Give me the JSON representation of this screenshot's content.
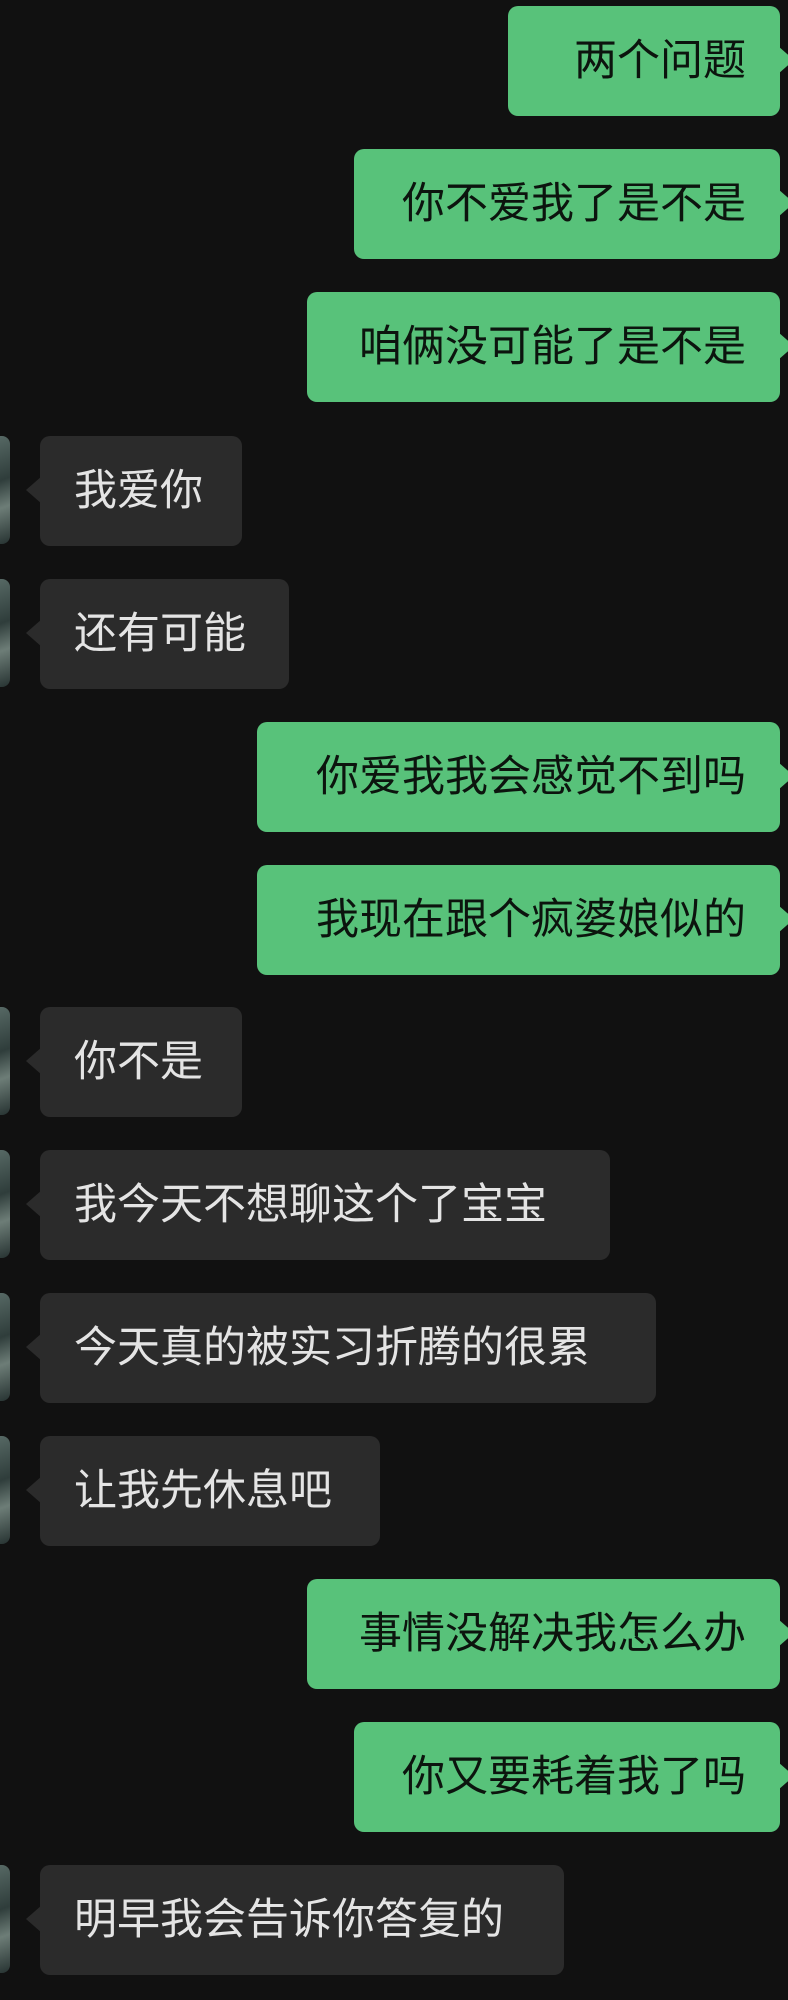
{
  "colors": {
    "background": "#111111",
    "outgoing_bubble": "#58c27a",
    "incoming_bubble": "#2b2b2b",
    "incoming_text": "#e4e4e4",
    "outgoing_text": "#0c140e"
  },
  "messages": [
    {
      "side": "outgoing",
      "text": "两个问题"
    },
    {
      "side": "outgoing",
      "text": "你不爱我了是不是"
    },
    {
      "side": "outgoing",
      "text": "咱俩没可能了是不是"
    },
    {
      "side": "incoming",
      "text": "我爱你"
    },
    {
      "side": "incoming",
      "text": "还有可能"
    },
    {
      "side": "outgoing",
      "text": "你爱我我会感觉不到吗"
    },
    {
      "side": "outgoing",
      "text": "我现在跟个疯婆娘似的"
    },
    {
      "side": "incoming",
      "text": "你不是"
    },
    {
      "side": "incoming",
      "text": "我今天不想聊这个了宝宝"
    },
    {
      "side": "incoming",
      "text": "今天真的被实习折腾的很累"
    },
    {
      "side": "incoming",
      "text": "让我先休息吧"
    },
    {
      "side": "outgoing",
      "text": "事情没解决我怎么办"
    },
    {
      "side": "outgoing",
      "text": "你又要耗着我了吗"
    },
    {
      "side": "incoming",
      "text": "明早我会告诉你答复的"
    }
  ]
}
